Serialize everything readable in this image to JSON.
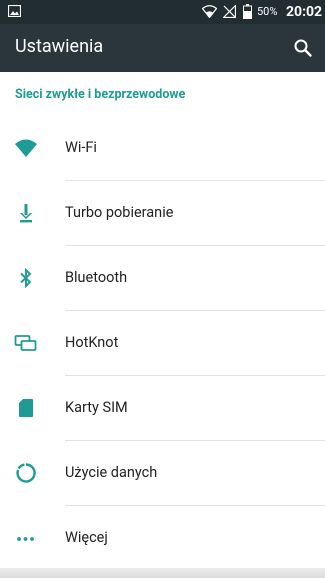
{
  "status_bar": {
    "battery": "50%",
    "time": "20:02"
  },
  "app_bar": {
    "title": "Ustawienia"
  },
  "section": {
    "title": "Sieci zwykłe i bezprzewodowe"
  },
  "items": [
    {
      "label": "Wi-Fi",
      "icon": "wifi-icon"
    },
    {
      "label": "Turbo pobieranie",
      "icon": "download-icon"
    },
    {
      "label": "Bluetooth",
      "icon": "bluetooth-icon"
    },
    {
      "label": "HotKnot",
      "icon": "hotknot-icon"
    },
    {
      "label": "Karty SIM",
      "icon": "sim-card-icon"
    },
    {
      "label": "Użycie danych",
      "icon": "data-usage-icon"
    },
    {
      "label": "Więcej",
      "icon": "more-icon"
    }
  ],
  "colors": {
    "accent": "#1e9b94",
    "app_bar": "#2a363b",
    "status_bar": "#222d32"
  }
}
